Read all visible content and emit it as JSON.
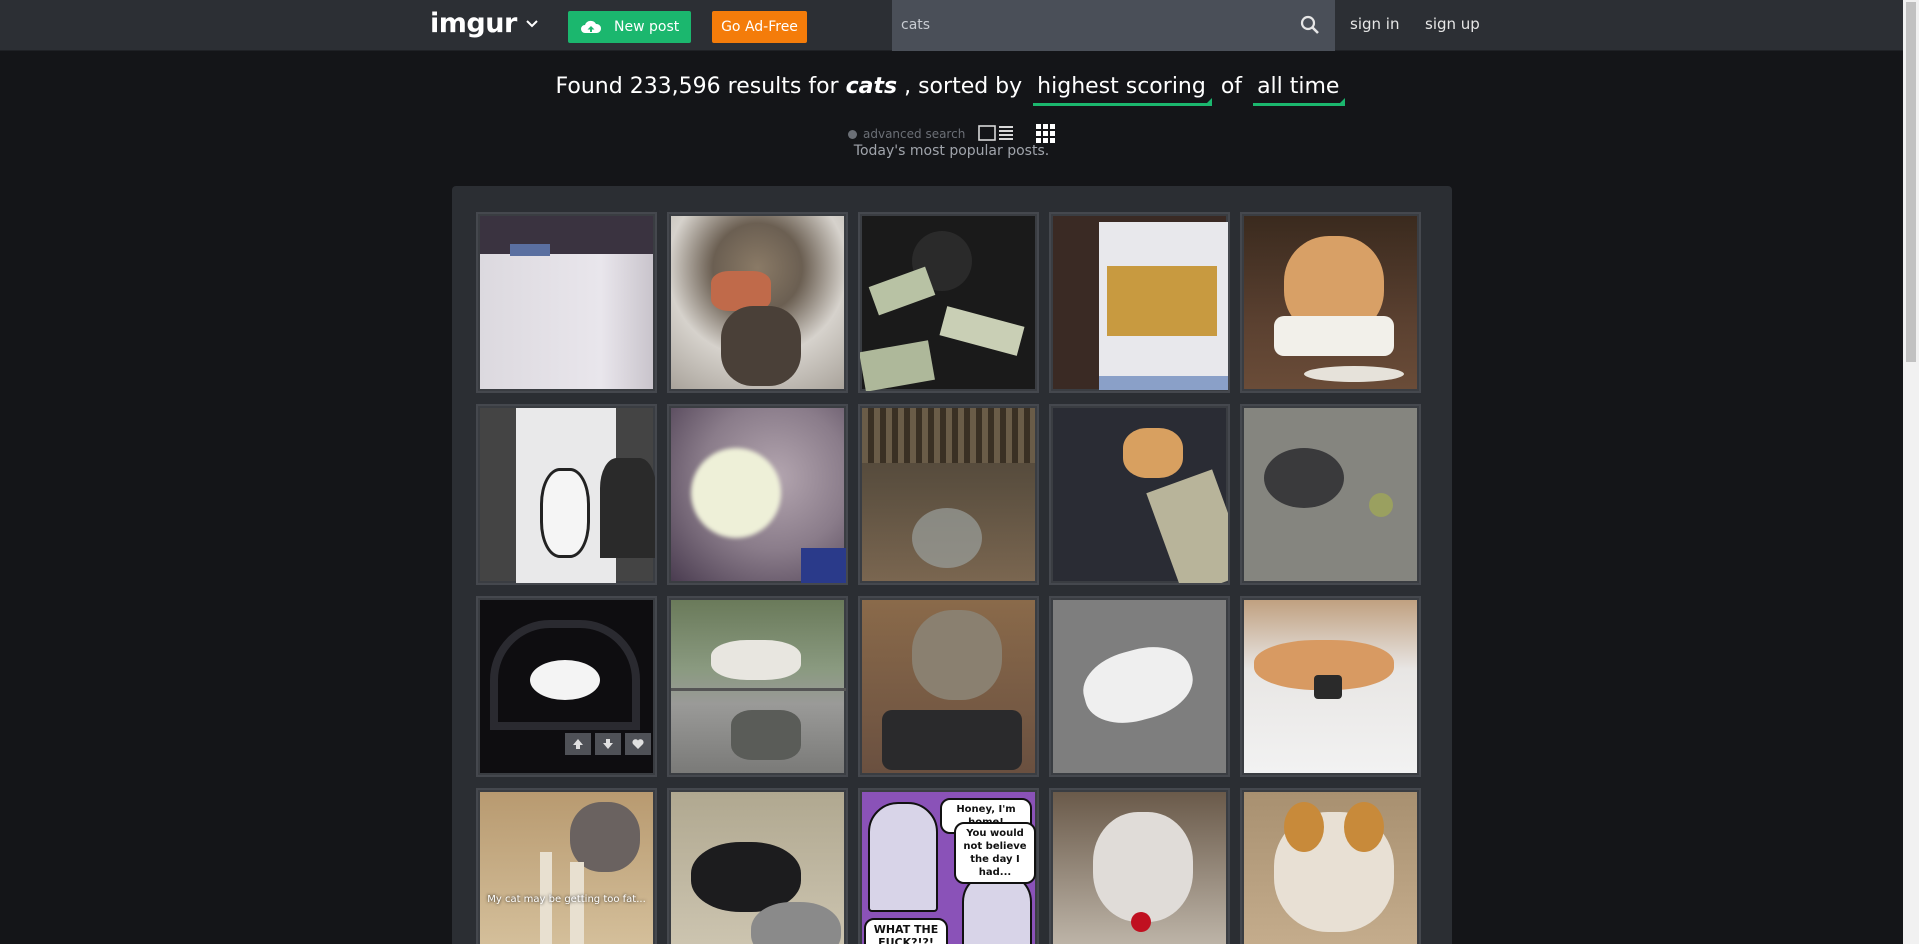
{
  "header": {
    "logo": "imgur",
    "new_post_label": "New post",
    "ad_free_label": "Go Ad-Free",
    "search_value": "cats",
    "sign_in_label": "sign in",
    "sign_up_label": "sign up"
  },
  "results": {
    "prefix": "Found 233,596 results for",
    "query": "cats",
    "sorted_by_label": ", sorted by",
    "sort_value": "highest scoring",
    "of_label": "of",
    "time_value": "all time",
    "advanced_search_label": "advanced search",
    "popular_caption": "Today's most popular posts."
  },
  "thumbnails": {
    "r1": [
      "cat video on shelf",
      "cat eating pizza",
      "cat on money",
      "cat on laptop screen",
      "cat with bib at dinner"
    ],
    "r2": [
      "cat in doorway",
      "blurry ball",
      "cat with bowl",
      "orange cat on street",
      "grey cat with ball"
    ],
    "r3": [
      "black and white cat on chair",
      "cat statue on street",
      "cat on desk",
      "white cat walking",
      "orange cat on bed"
    ],
    "r4_caption": "My cat may be getting too fat...",
    "comic_bubbles": [
      "Honey, I'm home!",
      "You would not believe the day I had...",
      "WHAT THE FUCK?!?!"
    ]
  },
  "colors": {
    "accent_green": "#1bb76e",
    "accent_orange": "#f47c0a",
    "topbar": "#2c2f34",
    "background": "#141518"
  }
}
